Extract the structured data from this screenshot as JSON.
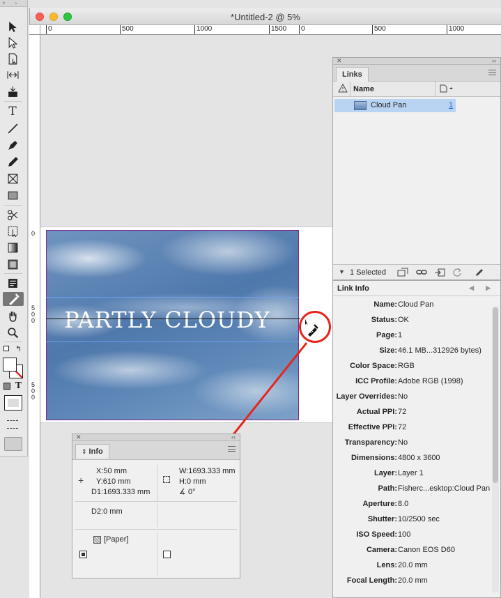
{
  "window": {
    "title": "*Untitled-2 @ 5%"
  },
  "ruler": {
    "h_labels": [
      "0",
      "500",
      "1000",
      "1500",
      "0",
      "500",
      "1000"
    ],
    "v_labels": [
      "0",
      "5",
      "0",
      "0",
      "5",
      "0",
      "0"
    ]
  },
  "document": {
    "heading_text": "PARTLY CLOUDY"
  },
  "links_panel": {
    "tab": "Links",
    "column_name": "Name",
    "rows": [
      {
        "name": "Cloud Pan",
        "page": "1"
      }
    ],
    "selected_count": "1 Selected"
  },
  "link_info": {
    "title": "Link Info",
    "fields": [
      {
        "key": "Name:",
        "value": "Cloud Pan"
      },
      {
        "key": "Status:",
        "value": "OK"
      },
      {
        "key": "Page:",
        "value": "1"
      },
      {
        "key": "Size:",
        "value": "46.1 MB...312926 bytes)"
      },
      {
        "key": "Color Space:",
        "value": "RGB"
      },
      {
        "key": "ICC Profile:",
        "value": "Adobe RGB (1998)"
      },
      {
        "key": "Layer Overrides:",
        "value": "No"
      },
      {
        "key": "Actual PPI:",
        "value": "72"
      },
      {
        "key": "Effective PPI:",
        "value": "72"
      },
      {
        "key": "Transparency:",
        "value": "No"
      },
      {
        "key": "Dimensions:",
        "value": "4800 x 3600"
      },
      {
        "key": "Layer:",
        "value": "Layer 1"
      },
      {
        "key": "Path:",
        "value": "Fisherc...esktop:Cloud Pan"
      },
      {
        "key": "Aperture:",
        "value": "8.0"
      },
      {
        "key": "Shutter:",
        "value": "10/2500 sec"
      },
      {
        "key": "ISO Speed:",
        "value": "100"
      },
      {
        "key": "Camera:",
        "value": "Canon EOS D60"
      },
      {
        "key": "Lens:",
        "value": "20.0 mm"
      },
      {
        "key": "Focal Length:",
        "value": "20.0 mm"
      }
    ]
  },
  "info_panel": {
    "tab": "Info",
    "x": "X:50 mm",
    "y": "Y:610 mm",
    "d1": "D1:1693.333 mm",
    "w": "W:1693.333 mm",
    "h": "H:0 mm",
    "angle": "0°",
    "d2": "D2:0 mm",
    "fill": "[Paper]"
  },
  "colors": {
    "accent_selection": "#b9d3f2",
    "callout_red": "#e4261c",
    "frame_purple": "#7a2a8a",
    "guide_blue": "#6aa0f0"
  }
}
